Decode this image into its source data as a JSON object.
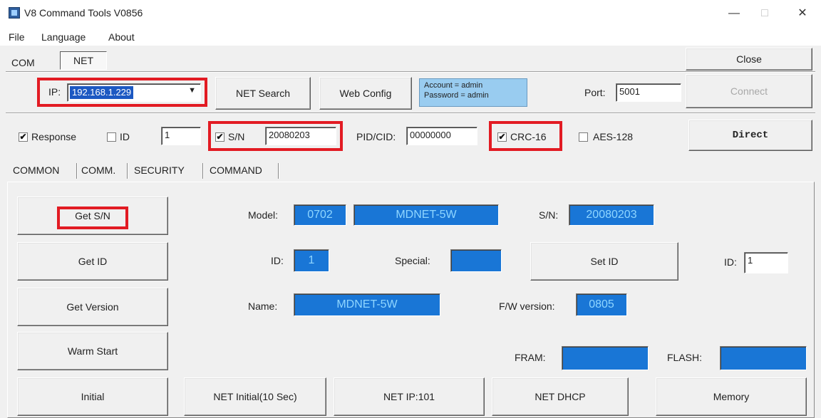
{
  "window": {
    "title": "V8 Command Tools V0856",
    "minimize": "—",
    "maximize": "□",
    "close": "✕"
  },
  "menu": [
    "File",
    "Language",
    "About"
  ],
  "conn_tabs": {
    "com": "COM",
    "net": "NET"
  },
  "close_button": "Close",
  "net_row": {
    "ip_label": "IP:",
    "ip_value": "192.168.1.229",
    "net_search": "NET Search",
    "web_config": "Web Config",
    "account": "Account = admin",
    "password": "Password = admin",
    "port_label": "Port:",
    "port_value": "5001",
    "connect": "Connect"
  },
  "options_row": {
    "response_label": "Response",
    "response_checked": "✔",
    "id_label": "ID",
    "id_value": "1",
    "sn_label": "S/N",
    "sn_checked": "✔",
    "sn_value": "20080203",
    "pid_label": "PID/CID:",
    "pid_value": "00000000",
    "crc_label": "CRC-16",
    "crc_checked": "✔",
    "aes_label": "AES-128",
    "direct": "Direct"
  },
  "tabs": [
    "COMMON",
    "COMM.",
    "SECURITY",
    "COMMAND"
  ],
  "common": {
    "get_sn": "Get S/N",
    "get_id": "Get ID",
    "get_version": "Get Version",
    "warm_start": "Warm Start",
    "initial": "Initial",
    "net_initial": "NET Initial(10 Sec)",
    "net_ip": "NET IP:101",
    "net_dhcp": "NET DHCP",
    "memory": "Memory",
    "set_id": "Set ID",
    "model_label": "Model:",
    "model_code": "0702",
    "model_name": "MDNET-5W",
    "sn_label": "S/N:",
    "sn_value": "20080203",
    "id_label": "ID:",
    "id_value": "1",
    "special_label": "Special:",
    "special_value": "",
    "set_id_label": "ID:",
    "set_id_value": "1",
    "name_label": "Name:",
    "name_value": "MDNET-5W",
    "fw_label": "F/W version:",
    "fw_value": "0805",
    "fram_label": "FRAM:",
    "fram_value": "",
    "flash_label": "FLASH:",
    "flash_value": ""
  },
  "colors": {
    "highlight_red": "#e21b23",
    "field_blue": "#1976d6",
    "field_text": "#8fd6ff",
    "info_blue": "#99ccf0"
  }
}
